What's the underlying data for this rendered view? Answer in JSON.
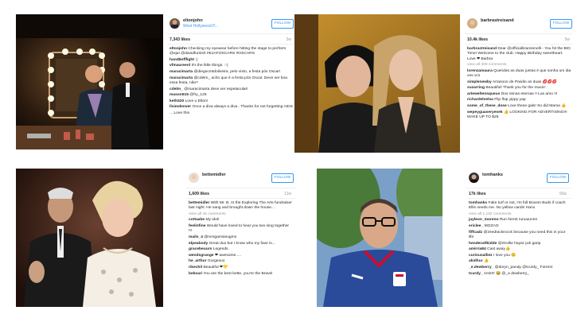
{
  "posts": [
    {
      "username": "eltonjohn",
      "location": "West Hollywood P...",
      "follow_label": "FOLLOW",
      "likes": "7,343 likes",
      "age": "3w",
      "caption": {
        "user": "eltonjohn",
        "text": "Checking my eyewear before hitting the stage to perform @eja! @davidfurnish #EJAFOSCARS #OSCARS"
      },
      "comments": [
        {
          "user": "hand$offlight",
          "text": ":)"
        },
        {
          "user": "vfmaureenl",
          "text": "It's the little things. :-)"
        },
        {
          "user": "maracimarta",
          "text": "@diegocmtdoliveira, pelo visto, a festa pós Oscar!"
        },
        {
          "user": "maracimarta",
          "text": "@cdelm_ acho que é a festa pós Oscar. Deve ser boa essa festa, não?"
        },
        {
          "user": "cdelm_",
          "text": "@maracimarta deve ser espetacular!"
        },
        {
          "user": "mason515",
          "text": "@fry_125"
        },
        {
          "user": "keth320",
          "text": "Love u Elton!"
        },
        {
          "user": "llsimdenver",
          "text": "Once a diva always a diva . Thanks for not forgetting AIDS"
        },
        {
          "user": "",
          "text": "... Love this"
        }
      ]
    },
    {
      "username": "barbrastreisand",
      "location": "",
      "follow_label": "FOLLOW",
      "likes": "10.4k likes",
      "age": "5w",
      "caption": {
        "user": "barbrastreisand",
        "text": "Dear @officiallizaminnelli - You hit the BIG Time! Welcome to the club. Happy Birthday sweetheart. Love ❤ Barbra"
      },
      "view_all": "view all 305 comments",
      "comments": [
        {
          "user": "lorenzamaura",
          "text": "Queridas as duas juntas é que sonha um dia ves vcs"
        },
        {
          "user": "simplenewby",
          "text": "Arrasooo de Paixão as duas 💋💋💋"
        },
        {
          "user": "suzarring",
          "text": "Beautiful! Thank you for the music!"
        },
        {
          "user": "arteweltensqueus",
          "text": "Dos reinas eternas !! Las amo !!!"
        },
        {
          "user": "richardelvelsa",
          "text": "Flip flop yippy yap."
        },
        {
          "user": "some_of_these_dose",
          "text": "Love these gals! So did Mama 👍"
        },
        {
          "user": "wepeyguaseryesek",
          "text": "👍 LOOKING FOR ADVERTISING!!! MAKE UP TO $25"
        }
      ]
    },
    {
      "username": "bettemidler",
      "location": "",
      "follow_label": "FOLLOW",
      "likes": "1,609 likes",
      "age": "11w",
      "caption": {
        "user": "bettemidler",
        "text": "With Mr. B. At the Exploring The Arts fundraiser last night. He sang and brought down the house..."
      },
      "view_all": "view all 45 comments",
      "comments": [
        {
          "user": "cottaabe",
          "text": "My idol!"
        },
        {
          "user": "feelinfine",
          "text": "Would have loved to hear you two sing together !!!"
        },
        {
          "user": "mails_4",
          "text": "@mrsgamsieugms"
        },
        {
          "user": "elpeabody",
          "text": "Great duo but I know who my fave is..."
        },
        {
          "user": "gracebeuurs",
          "text": "Legends."
        },
        {
          "user": "wendsgrange",
          "text": "❤ awesome....."
        },
        {
          "user": "he_arthur",
          "text": "Gorgeous"
        },
        {
          "user": "rikechil",
          "text": "Beautiful ❤💛"
        },
        {
          "user": "beksari",
          "text": "You are the best bette, you're the Bravel"
        }
      ]
    },
    {
      "username": "tomhanks",
      "location": "",
      "follow_label": "FOLLOW",
      "likes": "17k likes",
      "age": "50w",
      "caption": {
        "user": "tomhanks",
        "text": "Fake turf or not, I'm full Boosm Buds if coach Ellis needs me. No yellow cards! Hanx"
      },
      "view_all": "view all 1,182 comments",
      "comments": [
        {
          "user": "jayleon_moreno",
          "text": "Run forest runuuunnn"
        },
        {
          "user": "ericlee_",
          "text": "MOZAO"
        },
        {
          "user": "fiffcadz",
          "text": "@zeedrackrocck because you need this in your life"
        },
        {
          "user": "hendecellkidde",
          "text": "@ztrollie hayat çok garip"
        },
        {
          "user": "amirria84",
          "text": "Cast away👍"
        },
        {
          "user": "curiousalliez",
          "text": "I love you 😊"
        },
        {
          "user": "akidhur",
          "text": "👍"
        },
        {
          "user": "_e.dewberry_",
          "text": "@doryn_pandy @tcurdy_ Forrest"
        },
        {
          "user": "tcurdy_",
          "text": "Amit!!! 😂 @_e.dewberry_"
        }
      ]
    }
  ]
}
